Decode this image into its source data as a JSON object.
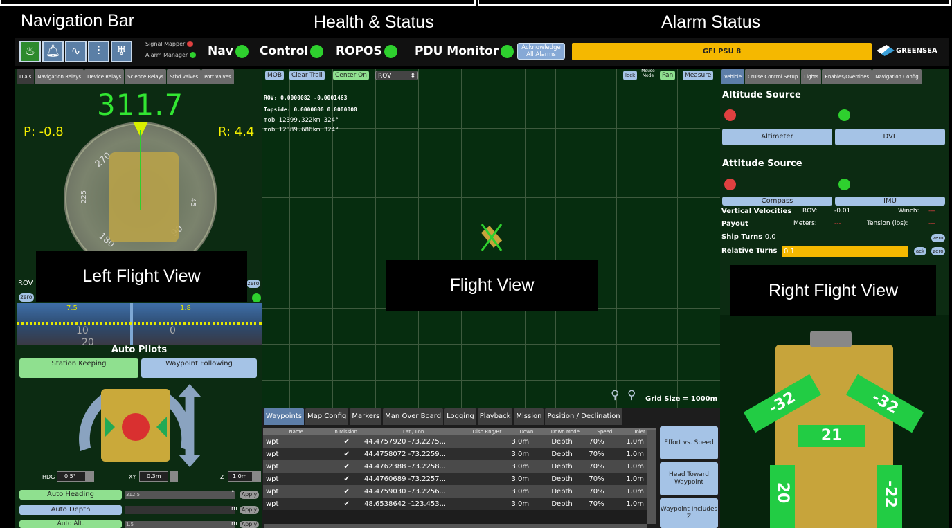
{
  "labels": {
    "navigation_bar": "Navigation Bar",
    "health_status": "Health & Status",
    "alarm_status": "Alarm Status",
    "left_flight_view": "Left Flight View",
    "flight_view": "Flight View",
    "right_flight_view": "Right Flight View"
  },
  "navbar": {
    "signal_mapper": "Signal Mapper",
    "alarm_manager": "Alarm Manager",
    "status": [
      "Nav",
      "Control",
      "ROPOS",
      "PDU Monitor"
    ],
    "ack_label": "Acknowledge All Alarms",
    "alarm_text": "GFI PSU 8",
    "logo": "GREENSEA",
    "icons": [
      "flame-icon",
      "bell-icon",
      "heartbeat-icon",
      "sliders-icon",
      "stethoscope-icon"
    ]
  },
  "left": {
    "tabs": [
      "Dials",
      "Navigation Relays",
      "Device Relays",
      "Science Relays",
      "Stbd valves",
      "Port valves"
    ],
    "heading": "311.7",
    "pitch": "P: -0.8",
    "roll": "R: 4.4",
    "dial_ticks": [
      "270",
      "225",
      "45",
      "180",
      "90"
    ],
    "rov_label": "ROV",
    "zero_label": "zero",
    "depth_left": "7.5",
    "depth_right": "1.8",
    "depth_scale": [
      "10",
      "0",
      "20"
    ],
    "autopilots_title": "Auto Pilots",
    "station_keeping": "Station Keeping",
    "waypoint_following": "Waypoint Following",
    "hdg_label": "HDG",
    "hdg_value": "0.5°",
    "xy_label": "XY",
    "xy_value": "0.3m",
    "z_label": "Z",
    "z_value": "1.0m",
    "auto_heading": "Auto Heading",
    "auto_heading_value": "312.5",
    "auto_heading_unit": "°",
    "auto_depth": "Auto Depth",
    "auto_depth_unit": "m",
    "auto_alt": "Auto Alt.",
    "auto_alt_value": "1.5",
    "auto_alt_unit": "m",
    "apply": "Apply"
  },
  "center": {
    "buttons": {
      "mob": "MOB",
      "clear_trail": "Clear Trail",
      "center_on": "Center On",
      "rov_select": "ROV",
      "lock": "lock",
      "mouse_mode": "Mouse Mode",
      "pan": "Pan",
      "measure": "Measure"
    },
    "coords": [
      "ROV: 0.0000082 -0.0001463",
      "Topside: 0.0000000 0.0000000",
      "mob 12399.322km 324°",
      "mob 12389.686km 324°"
    ],
    "grid_size": "Grid Size = 1000m"
  },
  "bottom": {
    "tabs": [
      "Waypoints",
      "Map Config",
      "Markers",
      "Man Over Board",
      "Logging",
      "Playback",
      "Mission",
      "Position / Declination"
    ],
    "columns": [
      "Name",
      "In Mission",
      "Lat / Lon",
      "Disp Rng/Br",
      "Down",
      "Down Mode",
      "Speed",
      "Toler"
    ],
    "rows": [
      [
        "wpt",
        "✔",
        "44.4757920 -73.2275...",
        "",
        "3.0m",
        "Depth",
        "70%",
        "1.0m"
      ],
      [
        "wpt",
        "✔",
        "44.4758072 -73.2259...",
        "",
        "3.0m",
        "Depth",
        "70%",
        "1.0m"
      ],
      [
        "wpt",
        "✔",
        "44.4762388 -73.2258...",
        "",
        "3.0m",
        "Depth",
        "70%",
        "1.0m"
      ],
      [
        "wpt",
        "✔",
        "44.4760689 -73.2257...",
        "",
        "3.0m",
        "Depth",
        "70%",
        "1.0m"
      ],
      [
        "wpt",
        "✔",
        "44.4759030 -73.2256...",
        "",
        "3.0m",
        "Depth",
        "70%",
        "1.0m"
      ],
      [
        "wpt",
        "✔",
        "48.6538642 -123.453...",
        "",
        "3.0m",
        "Depth",
        "70%",
        "1.0m"
      ]
    ],
    "side_buttons": [
      "Effort vs. Speed",
      "Head Toward Waypoint",
      "Waypoint Includes Z"
    ]
  },
  "right": {
    "tabs": [
      "Vehicle",
      "Cruise Control Setup",
      "Lights",
      "Enables/Overrides",
      "Navigation Config"
    ],
    "altitude_source": "Altitude Source",
    "altimeter": "Altimeter",
    "dvl": "DVL",
    "attitude_source": "Attitude Source",
    "compass": "Compass",
    "imu": "IMU",
    "vertical_velocities": "Vertical Velocities",
    "rov_label": "ROV:",
    "rov_value": "-0.01",
    "winch_label": "Winch:",
    "winch_value": "---",
    "payout": "Payout",
    "meters_label": "Meters:",
    "meters_value": "---",
    "tension_label": "Tension (lbs):",
    "tension_value": "---",
    "ship_turns": "Ship Turns",
    "ship_turns_value": "0.0",
    "relative_turns": "Relative Turns",
    "relative_turns_value": "0.1",
    "zero": "zero",
    "ack": "ack",
    "thrusters": [
      "-32",
      "-32",
      "21",
      "20",
      "-22"
    ]
  }
}
